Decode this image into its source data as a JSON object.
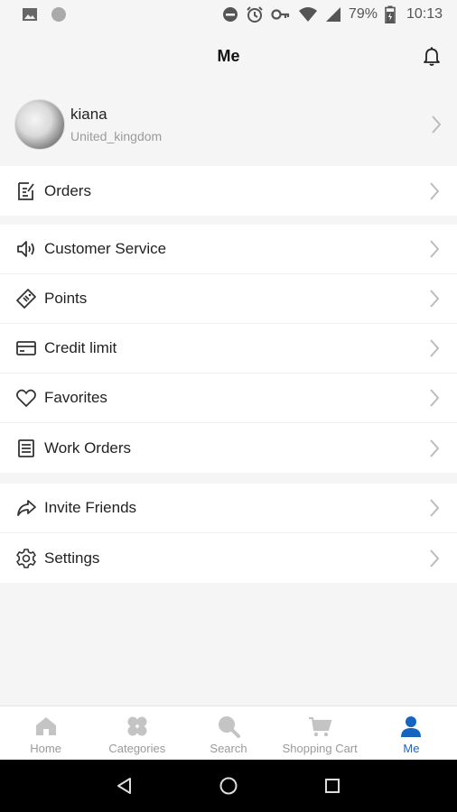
{
  "status_bar": {
    "battery": "79%",
    "time": "10:13"
  },
  "header": {
    "title": "Me"
  },
  "profile": {
    "name": "kiana",
    "country": "United_kingdom"
  },
  "menu": {
    "group1": [
      {
        "label": "Orders",
        "icon": "orders-icon"
      }
    ],
    "group2": [
      {
        "label": "Customer Service",
        "icon": "speaker-icon"
      },
      {
        "label": "Points",
        "icon": "tag-icon"
      },
      {
        "label": "Credit limit",
        "icon": "credit-card-icon"
      },
      {
        "label": "Favorites",
        "icon": "heart-icon"
      },
      {
        "label": "Work Orders",
        "icon": "list-icon"
      }
    ],
    "group3": [
      {
        "label": "Invite Friends",
        "icon": "share-icon"
      },
      {
        "label": "Settings",
        "icon": "gear-icon"
      }
    ]
  },
  "tabs": [
    {
      "label": "Home",
      "icon": "home-icon",
      "active": false
    },
    {
      "label": "Categories",
      "icon": "categories-icon",
      "active": false
    },
    {
      "label": "Search",
      "icon": "search-icon",
      "active": false
    },
    {
      "label": "Shopping Cart",
      "icon": "cart-icon",
      "active": false
    },
    {
      "label": "Me",
      "icon": "person-icon",
      "active": true
    }
  ],
  "colors": {
    "accent": "#1565c0",
    "inactive": "#bdbdbd",
    "background": "#f5f5f5"
  }
}
